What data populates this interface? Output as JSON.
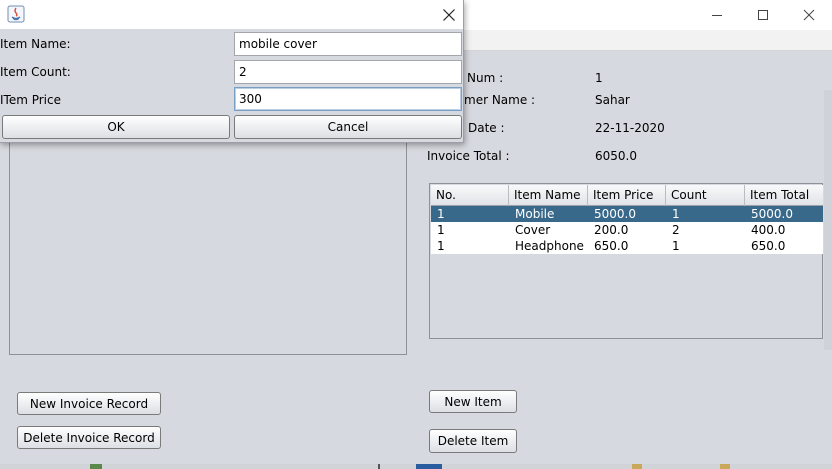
{
  "main_window": {
    "header_labels": {
      "invoice_num": "Num :",
      "customer_name": "mer Name :",
      "invoice_date": "Date :",
      "invoice_total": "Invoice Total :"
    },
    "header_values": {
      "invoice_num": "1",
      "customer_name": "Sahar",
      "invoice_date": "22-11-2020",
      "invoice_total": "6050.0"
    },
    "buttons": {
      "new_invoice": "New Invoice Record",
      "delete_invoice": "Delete Invoice Record",
      "new_item": "New Item",
      "delete_item": "Delete Item"
    },
    "items_table": {
      "columns": [
        "No.",
        "Item Name",
        "Item Price",
        "Count",
        "Item Total"
      ],
      "rows": [
        {
          "no": "1",
          "name": "Mobile",
          "price": "5000.0",
          "count": "1",
          "total": "5000.0",
          "selected": true
        },
        {
          "no": "1",
          "name": "Cover",
          "price": "200.0",
          "count": "2",
          "total": "400.0",
          "selected": false
        },
        {
          "no": "1",
          "name": "Headphone",
          "price": "650.0",
          "count": "1",
          "total": "650.0",
          "selected": false
        }
      ],
      "selection_color": "#39698a"
    }
  },
  "dialog": {
    "fields": {
      "item_name_label": "Item Name:",
      "item_name_value": "mobile cover",
      "item_count_label": "Item Count:",
      "item_count_value": "2",
      "item_price_label": "ITem Price",
      "item_price_value": "300"
    },
    "buttons": {
      "ok": "OK",
      "cancel": "Cancel"
    }
  },
  "icons": [
    "java-icon",
    "close-icon",
    "minimize-icon",
    "maximize-icon"
  ]
}
